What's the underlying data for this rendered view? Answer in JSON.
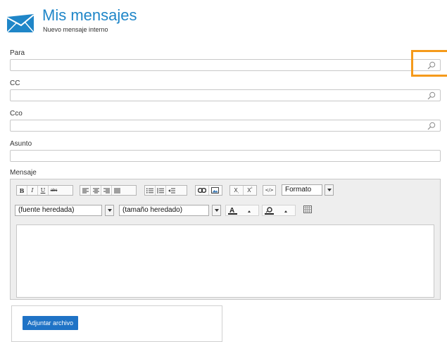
{
  "header": {
    "title": "Mis mensajes",
    "subtitle": "Nuevo mensaje interno",
    "icon": "envelope-icon"
  },
  "fields": {
    "para": {
      "label": "Para",
      "value": "",
      "icon": "search-icon"
    },
    "cc": {
      "label": "CC",
      "value": "",
      "icon": "search-icon"
    },
    "cco": {
      "label": "Cco",
      "value": "",
      "icon": "search-icon"
    },
    "asunto": {
      "label": "Asunto",
      "value": ""
    }
  },
  "editor": {
    "label": "Mensaje",
    "toolbar": {
      "bold": "B",
      "italic": "I",
      "underline": "U",
      "strike": "abc",
      "subscript": "X",
      "superscript": "X",
      "source": "</>",
      "format_label": "Formato"
    },
    "font_family": "(fuente heredada)",
    "font_size": "(tamaño heredado)",
    "body": ""
  },
  "attach": {
    "button_label": "Adjuntar archivo"
  },
  "colors": {
    "brand": "#1f86c8",
    "button": "#1f73c6",
    "highlight": "#f59a1b"
  }
}
